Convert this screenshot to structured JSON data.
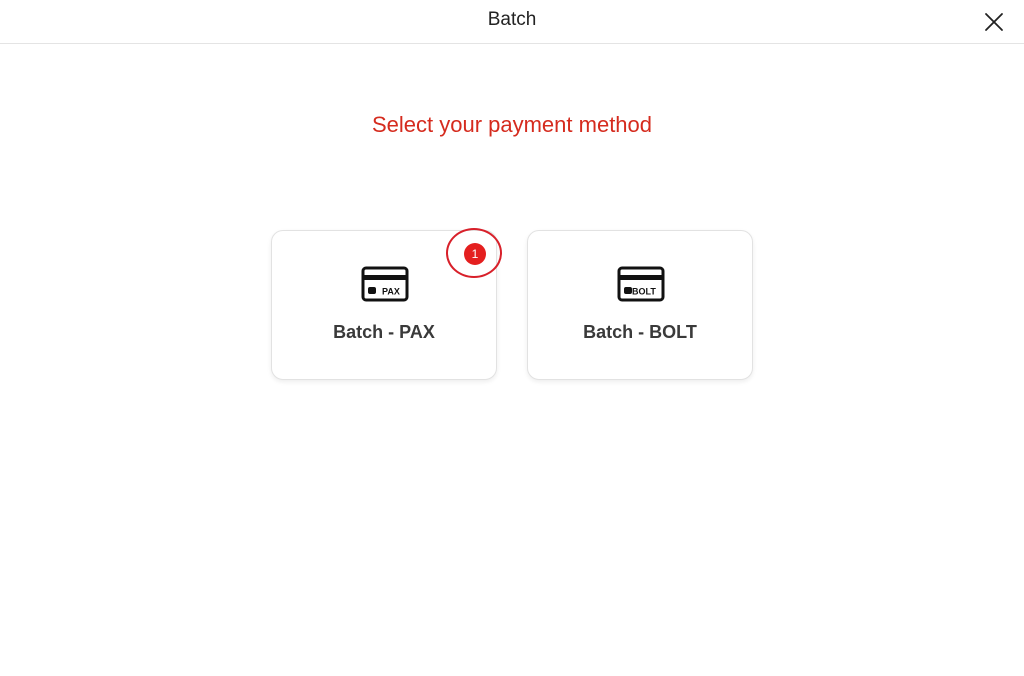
{
  "header": {
    "title": "Batch",
    "close_icon": "close-icon"
  },
  "main": {
    "heading": "Select your payment method",
    "options": [
      {
        "label": "Batch - PAX",
        "icon": "credit-card-icon",
        "icon_text": "PAX",
        "badge": "1"
      },
      {
        "label": "Batch - BOLT",
        "icon": "credit-card-icon",
        "icon_text": "BOLT"
      }
    ]
  },
  "colors": {
    "accent": "#d52b1e",
    "badge": "#e41f1f",
    "text": "#3a3a3a",
    "border": "#e2e2e2"
  }
}
